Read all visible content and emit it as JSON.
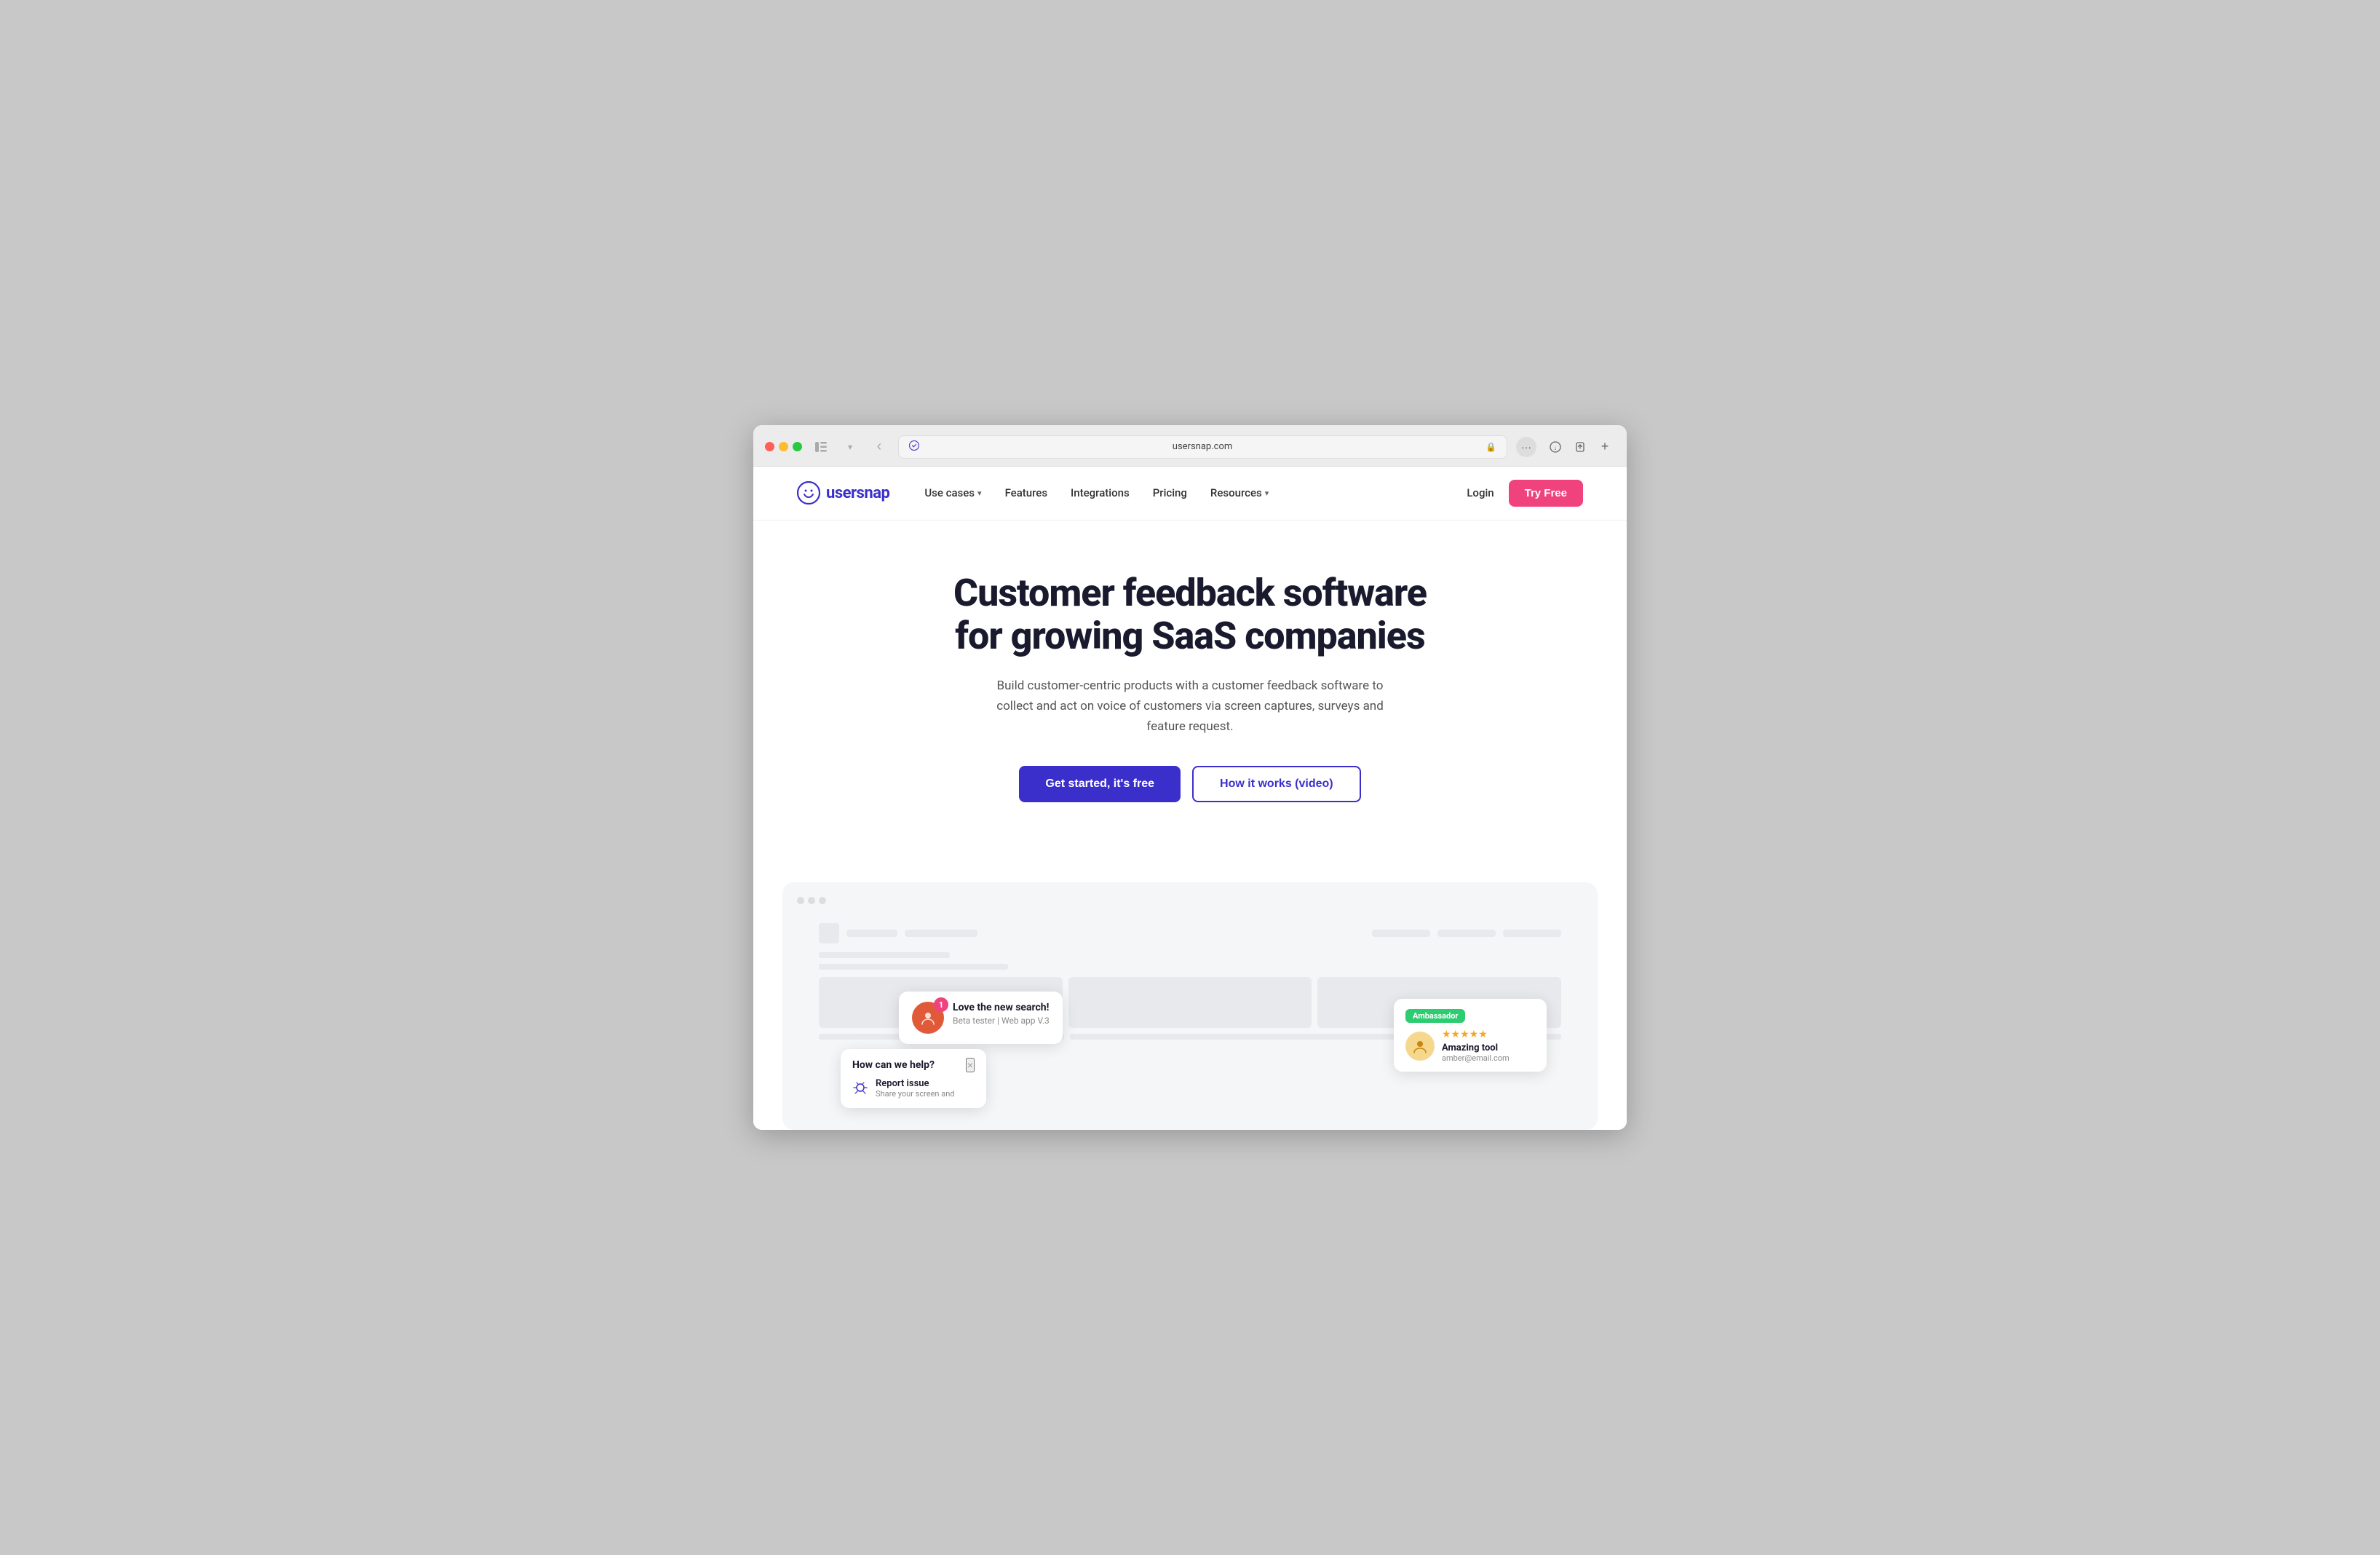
{
  "browser": {
    "address": "usersnap.com",
    "address_icon": "🔒",
    "more_icon": "···",
    "nav_back": "‹",
    "sidebar_icon": "▢",
    "download_icon": "⬇",
    "share_icon": "⎋",
    "new_tab_icon": "+"
  },
  "nav": {
    "logo_text": "usersnap",
    "links": [
      {
        "label": "Use cases",
        "has_chevron": true
      },
      {
        "label": "Features",
        "has_chevron": false
      },
      {
        "label": "Integrations",
        "has_chevron": false
      },
      {
        "label": "Pricing",
        "has_chevron": false
      },
      {
        "label": "Resources",
        "has_chevron": true
      }
    ],
    "login_label": "Login",
    "try_free_label": "Try Free"
  },
  "hero": {
    "title": "Customer feedback software for growing SaaS companies",
    "subtitle": "Build customer-centric products with a customer feedback software to collect and act on voice of customers via screen captures, surveys and feature request.",
    "cta_primary": "Get started, it's free",
    "cta_secondary": "How it works (video)"
  },
  "preview": {
    "feedback_card": {
      "title": "Love the new search!",
      "meta": "Beta tester | Web app V.3",
      "badge": "1"
    },
    "review_card": {
      "badge": "Ambassador",
      "stars": "★★★★★",
      "title": "Amazing tool",
      "email": "amber@email.com"
    },
    "help_widget": {
      "title": "How can we help?",
      "close": "×",
      "item_title": "Report issue",
      "item_desc": "Share your screen and"
    }
  },
  "colors": {
    "primary": "#3b2fcc",
    "pink": "#f0437e",
    "green": "#2ecc71",
    "dark": "#1a1a2e",
    "gray": "#e8e9ed"
  }
}
